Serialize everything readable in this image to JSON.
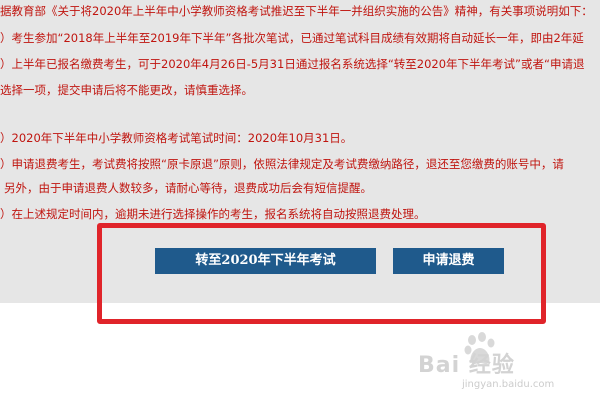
{
  "notice": {
    "lines": [
      "据教育部《关于将2020年上半年中小学教师资格考试推迟至下半年一并组织实施的公告》精神，有关事项说明如下：",
      "）考生参加“2018年上半年至2019年下半年”各批次笔试，已通过笔试科目成绩有效期将自动延长一年，即由2年延",
      "）上半年已报名缴费考生，可于2020年4月26日-5月31日通过报名系统选择“转至2020年下半年考试”或者“申请退",
      "选择一项，提交申请后将不能更改，请慎重选择。",
      "）2020年下半年中小学教师资格考试笔试时间：2020年10月31日。",
      "）申请退费考生，考试费将按照“原卡原退”原则，依照法律规定及考试费缴纳路径，退还至您缴费的账号中，请",
      "另外，由于申请退费人数较多，请耐心等待，退费成功后会有短信提醒。",
      "）在上述规定时间内，逾期未进行选择操作的考生，报名系统将自动按照退费处理。"
    ]
  },
  "buttons": {
    "transfer_label": "转至2020年下半年考试",
    "refund_label": "申请退费"
  },
  "watermark": {
    "logo_text": "Bai 经验",
    "url": "jingyan.baidu.com"
  },
  "colors": {
    "notice_text": "#c0150f",
    "notice_bg": "#e6e6e6",
    "button_bg": "#1f5a8c",
    "highlight_border": "#e0242a"
  }
}
